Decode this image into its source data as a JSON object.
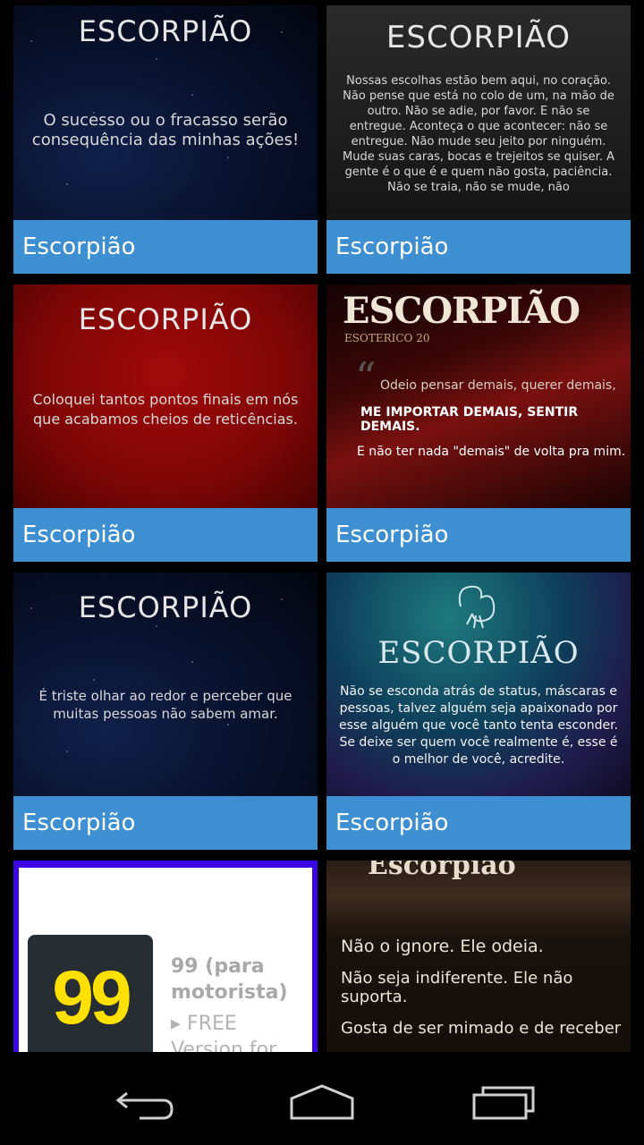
{
  "cards": [
    {
      "heading": "ESCORPIÃO",
      "quote": "O sucesso ou o fracasso serão consequência das minhas ações!",
      "label": "Escorpião"
    },
    {
      "heading": "ESCORPIÃO",
      "quote": "Nossas escolhas estão bem aqui, no coração. Não pense que está no colo de um, na mão de outro. Não se adie, por favor. E não se entregue. Aconteça o que acontecer: não se entregue. Não mude seu jeito por ninguém. Mude suas caras, bocas e trejeitos se quiser. A gente é o que é e quem não gosta, paciência. Não se traia, não se mude, não",
      "label": "Escorpião"
    },
    {
      "heading": "ESCORPIÃO",
      "quote": "Coloquei tantos pontos finais em nós que acabamos cheios de reticências.",
      "label": "Escorpião"
    },
    {
      "heading": "ESCORPIÃO",
      "sub_heading": "ESOTERICO 20",
      "quote_line1": "Odeio pensar demais, querer demais,",
      "quote_line2": "ME IMPORTAR DEMAIS, SENTIR DEMAIS.",
      "quote_line3": "E não ter nada \"demais\" de volta pra mim.",
      "label": "Escorpião"
    },
    {
      "heading": "ESCORPIÃO",
      "quote": "É triste olhar ao redor e perceber que muitas pessoas não sabem amar.",
      "label": "Escorpião"
    },
    {
      "heading": "ESCORPIÃO",
      "quote": "Não se esconda atrás de status, máscaras e pessoas, talvez alguém seja apaixonado por esse alguém que você tanto tenta esconder. Se deixe ser quem você realmente é, esse é o melhor de você, acredite.",
      "label": "Escorpião"
    }
  ],
  "ad": {
    "icon_text": "99",
    "title": "99 (para motorista)",
    "subtitle": "▸ FREE Version for"
  },
  "last_card": {
    "heading": "Escorpião",
    "line1": "Não o ignore. Ele odeia.",
    "line2": "Não seja indiferente. Ele não suporta.",
    "line3": "Gosta de ser mimado e de receber"
  },
  "nav": {
    "back_icon": "back-icon",
    "home_icon": "home-icon",
    "recents_icon": "recents-icon"
  }
}
